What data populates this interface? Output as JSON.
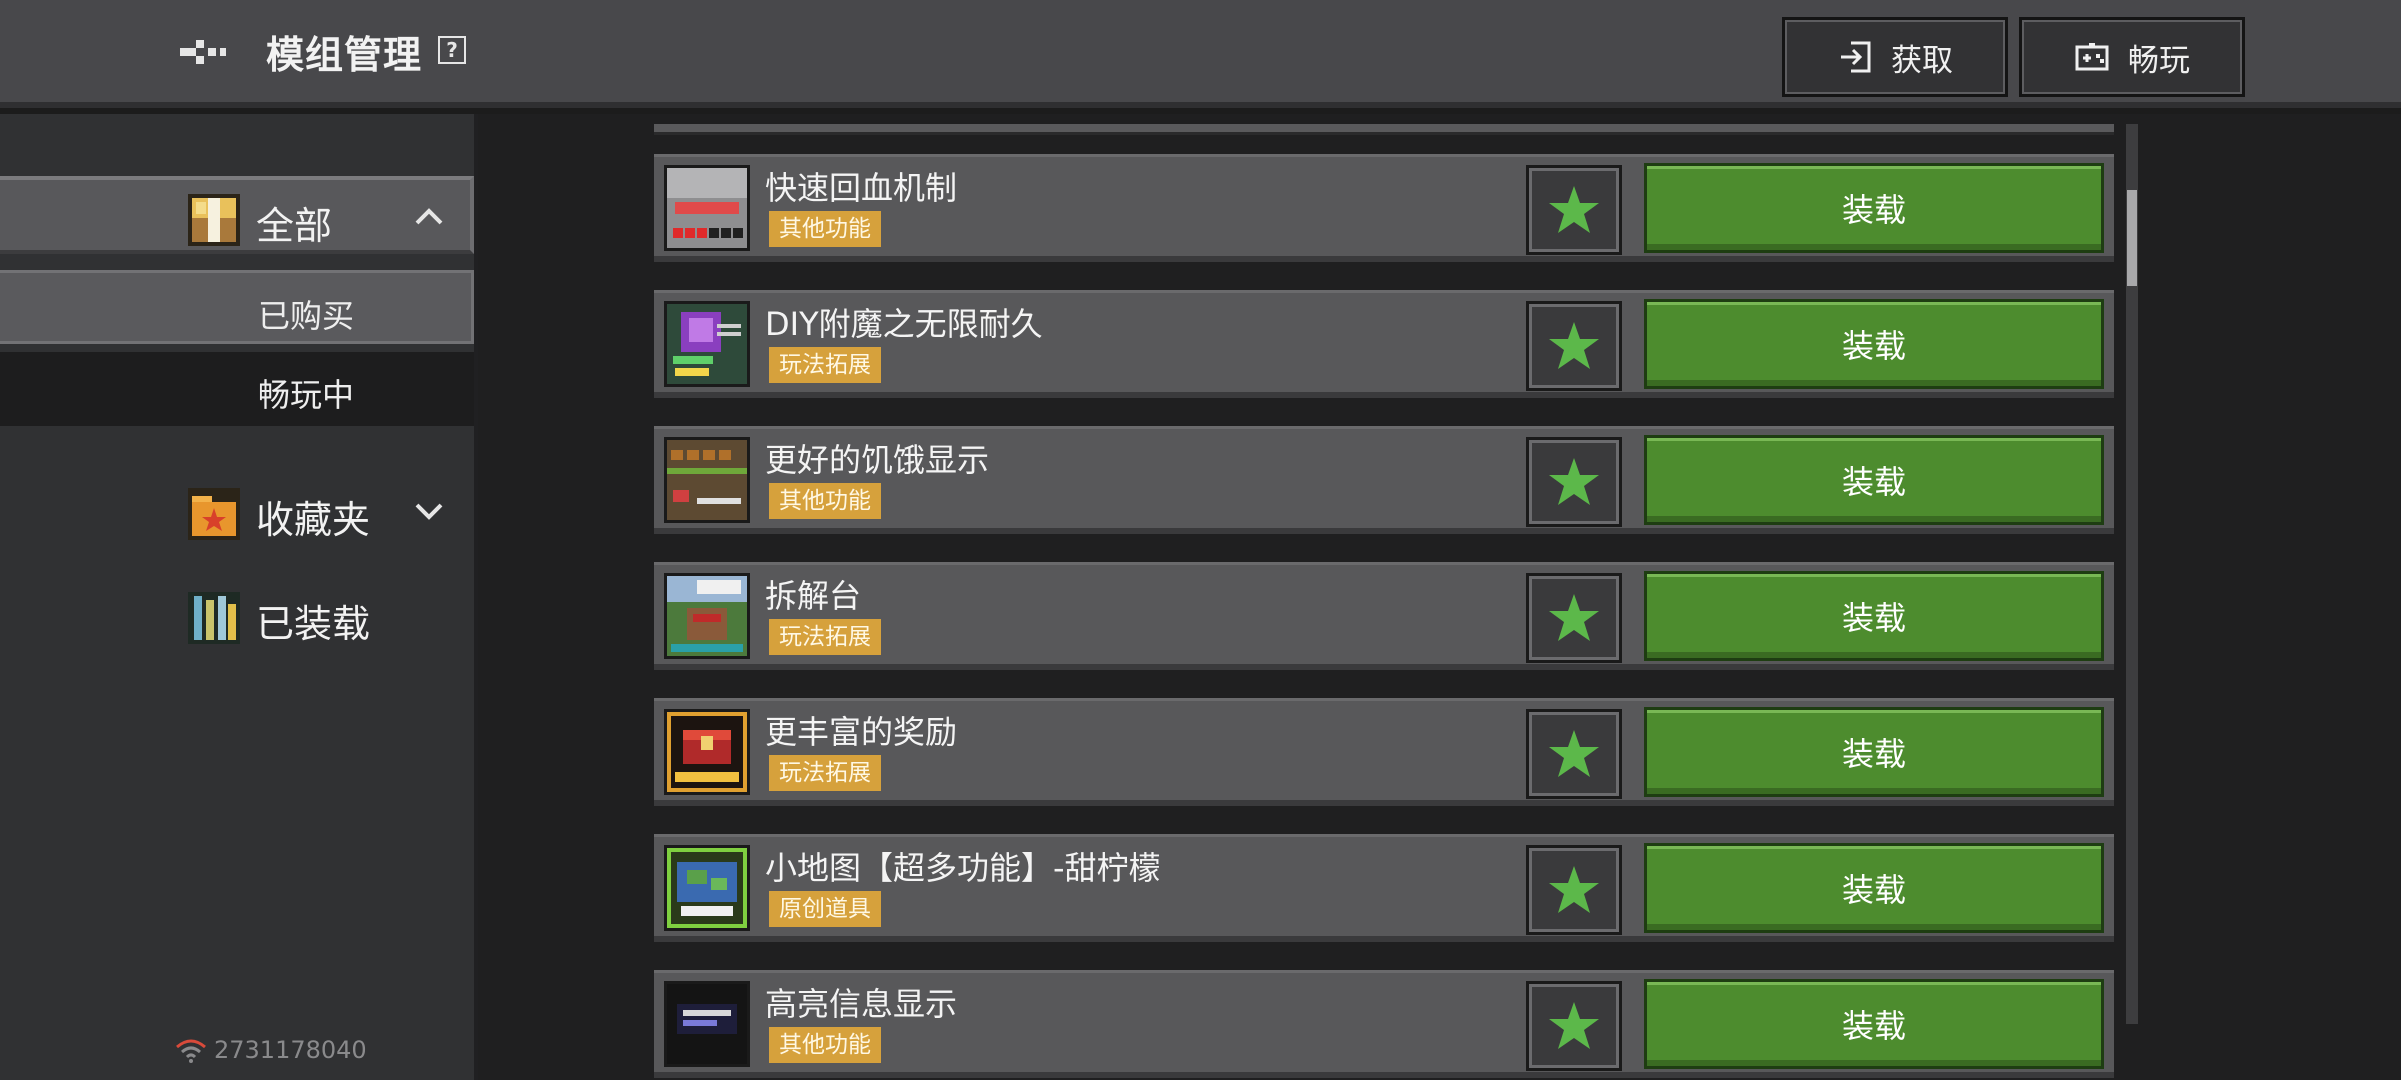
{
  "header": {
    "title": "模组管理",
    "help": "?",
    "get_button": "获取",
    "play_button": "畅玩"
  },
  "sidebar": {
    "all": "全部",
    "purchased": "已购买",
    "playing": "畅玩中",
    "favorites": "收藏夹",
    "loaded": "已装载",
    "account": "2731178040"
  },
  "mods": [
    {
      "name": "快速回血机制",
      "tag": "其他功能",
      "action": "装载"
    },
    {
      "name": "DIY附魔之无限耐久",
      "tag": "玩法拓展",
      "action": "装载"
    },
    {
      "name": "更好的饥饿显示",
      "tag": "其他功能",
      "action": "装载"
    },
    {
      "name": "拆解台",
      "tag": "玩法拓展",
      "action": "装载"
    },
    {
      "name": "更丰富的奖励",
      "tag": "玩法拓展",
      "action": "装载"
    },
    {
      "name": "小地图【超多功能】-甜柠檬",
      "tag": "原创道具",
      "action": "装载"
    },
    {
      "name": "高亮信息显示",
      "tag": "其他功能",
      "action": "装载"
    }
  ],
  "colors": {
    "load_green": "#4d8c2e",
    "tag_gold": "#d6a13c",
    "star_green": "#5cb84a"
  }
}
